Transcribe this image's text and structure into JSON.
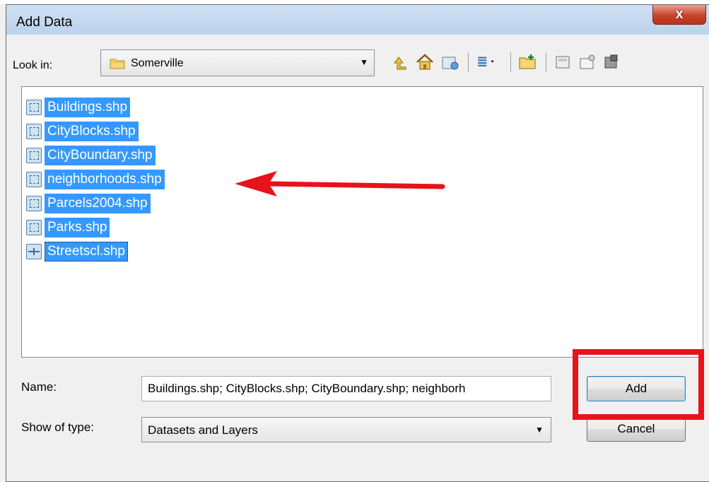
{
  "window": {
    "title": "Add Data",
    "close_symbol": "x"
  },
  "lookin": {
    "label": "Look in:",
    "value": "Somerville",
    "folder_icon": "folder-icon"
  },
  "toolbar": {
    "icons": [
      "up-one-level-icon",
      "home-icon",
      "connect-to-folder-icon",
      "view-menu-icon",
      "new-folder-icon",
      "catalog-icons"
    ]
  },
  "files": [
    {
      "name": "Buildings.shp",
      "type": "polygon"
    },
    {
      "name": "CityBlocks.shp",
      "type": "polygon"
    },
    {
      "name": "CityBoundary.shp",
      "type": "polygon"
    },
    {
      "name": "neighborhoods.shp",
      "type": "polygon"
    },
    {
      "name": "Parcels2004.shp",
      "type": "polygon"
    },
    {
      "name": "Parks.shp",
      "type": "polygon"
    },
    {
      "name": "Streetscl.shp",
      "type": "line"
    }
  ],
  "name_field": {
    "label": "Name:",
    "value": "Buildings.shp; CityBlocks.shp; CityBoundary.shp; neighborh"
  },
  "type_field": {
    "label": "Show of type:",
    "value": "Datasets and Layers"
  },
  "buttons": {
    "add": "Add",
    "cancel": "Cancel"
  },
  "colors": {
    "selection": "#3399ff",
    "annotation": "#e8121b"
  }
}
